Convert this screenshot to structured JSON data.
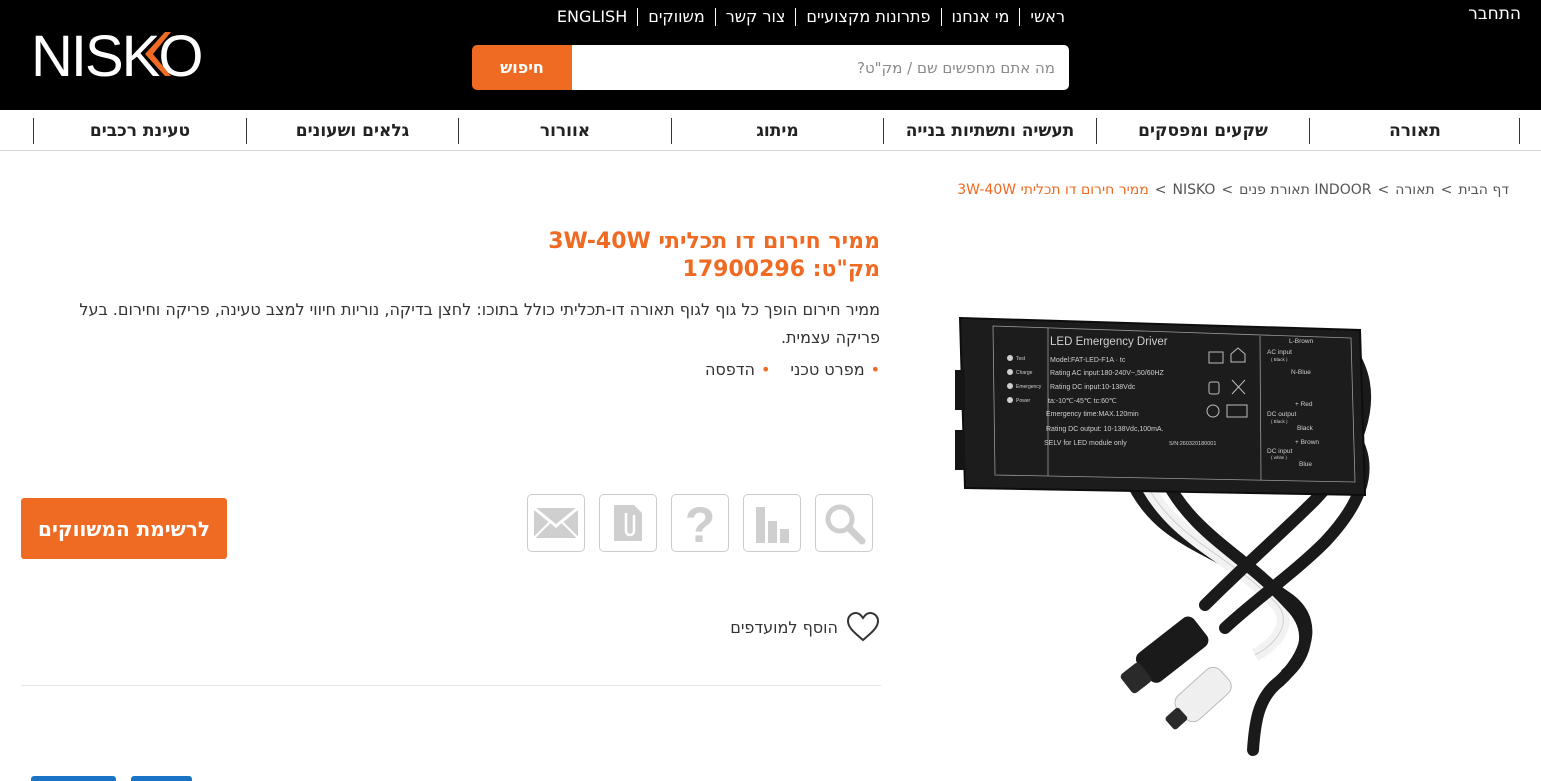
{
  "brand": {
    "logo_text": "NISKO",
    "accent_color": "#ef6a22"
  },
  "header": {
    "login_label": "התחבר",
    "top_nav": [
      "ראשי",
      "מי אנחנו",
      "פתרונות מקצועיים",
      "צור קשר",
      "משווקים",
      "ENGLISH"
    ],
    "search": {
      "placeholder": "מה אתם מחפשים שם / מק\"ט?",
      "button_label": "חיפוש"
    }
  },
  "categories": [
    "תאורה",
    "שקעים ומפסקים",
    "תעשיה ותשתיות בנייה",
    "מיתוג",
    "אוורור",
    "גלאים ושעונים",
    "טעינת רכבים"
  ],
  "breadcrumb": {
    "items": [
      "דף הבית",
      "תאורה",
      "INDOOR תאורת פנים",
      "NISKO"
    ],
    "current": "ממיר חירום דו תכליתי 3W-40W",
    "separator": ">"
  },
  "product": {
    "title": "ממיר חירום דו תכליתי 3W-40W",
    "sku_label": "מק\"ט: 17900296",
    "description": "ממיר חירום הופך כל גוף לגוף תאורה דו-תכליתי כולל בתוכו: לחצן בדיקה, נוריות חיווי למצב טעינה, פריקה וחירום. בעל פריקה עצמית.",
    "links": [
      "מפרט טכני",
      "הדפסה"
    ],
    "dealers_button": "לרשימת המשווקים",
    "favorites_label": "הוסף למועדפים",
    "action_icons": [
      "search-icon",
      "chart-icon",
      "question-icon",
      "document-icon",
      "mail-icon"
    ]
  },
  "product_image": {
    "heading": "LED Emergency Driver",
    "model": "Model:FAT-LED-F1A · tc",
    "lines": [
      "Rating AC input:180-240V~,50/60HZ",
      "Rating DC input:10-138Vdc",
      "ta:-10℃-45℃  tc:60℃",
      "Emergency time:MAX.120min",
      "Rating DC output: 10-138Vdc,100mA.",
      "SELV for LED module only"
    ],
    "serial": "S/N:260320180001",
    "indicators": [
      "Test",
      "Charge",
      "Emergency",
      "Power"
    ],
    "side_labels": [
      "L-Brown",
      "AC input",
      "( Black )",
      "N-Blue",
      "+ Red",
      "DC output",
      "( Black )",
      "Black",
      "+ Brown",
      "DC input",
      "( white )",
      "Blue"
    ]
  }
}
